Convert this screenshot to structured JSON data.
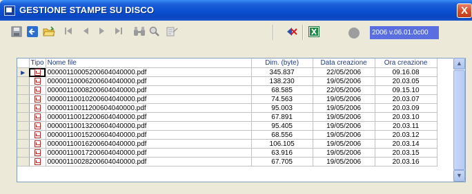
{
  "window": {
    "title": "GESTIONE STAMPE SU DISCO",
    "close_label": "X"
  },
  "toolbar": {
    "icons": [
      "save-icon",
      "back-arrow-icon",
      "open-folder-icon",
      "first-record-icon",
      "previous-record-icon",
      "next-record-icon",
      "last-record-icon",
      "binoculars-icon",
      "zoom-icon",
      "scan-icon",
      "delete-icon",
      "excel-icon"
    ],
    "status_indicator_color": "#9e9e9e",
    "version": "2006 v.06.01.0c00"
  },
  "grid": {
    "columns": [
      "Tipo",
      "Nome file",
      "Dim. (byte)",
      "Data creazione",
      "Ora creazione"
    ],
    "rows": [
      {
        "name": "00000110005200604040000.pdf",
        "size": "345.837",
        "date": "22/05/2006",
        "time": "09.16.08"
      },
      {
        "name": "00000110006200604040000.pdf",
        "size": "138.230",
        "date": "19/05/2006",
        "time": "20.03.05"
      },
      {
        "name": "00000110008200604040000.pdf",
        "size": "68.585",
        "date": "22/05/2006",
        "time": "09.15.10"
      },
      {
        "name": "00000110010200604040000.pdf",
        "size": "74.563",
        "date": "19/05/2006",
        "time": "20.03.07"
      },
      {
        "name": "00000110011200604040000.pdf",
        "size": "95.003",
        "date": "19/05/2006",
        "time": "20.03.09"
      },
      {
        "name": "00000110012200604040000.pdf",
        "size": "67.891",
        "date": "19/05/2006",
        "time": "20.03.10"
      },
      {
        "name": "00000110013200604040000.pdf",
        "size": "95.405",
        "date": "19/05/2006",
        "time": "20.03.11"
      },
      {
        "name": "00000110015200604040000.pdf",
        "size": "68.556",
        "date": "19/05/2006",
        "time": "20.03.12"
      },
      {
        "name": "00000110016200604040000.pdf",
        "size": "106.105",
        "date": "19/05/2006",
        "time": "20.03.14"
      },
      {
        "name": "00000110017200604040000.pdf",
        "size": "63.916",
        "date": "19/05/2006",
        "time": "20.03.15"
      },
      {
        "name": "00000110028200604040000.pdf",
        "size": "67.705",
        "date": "19/05/2006",
        "time": "20.03.16"
      }
    ],
    "selected_row_indicator": "▶"
  },
  "colors": {
    "titlebar": "#0b4fd0",
    "window_bg": "#ece9d8",
    "version_box": "#5a6ee0"
  }
}
